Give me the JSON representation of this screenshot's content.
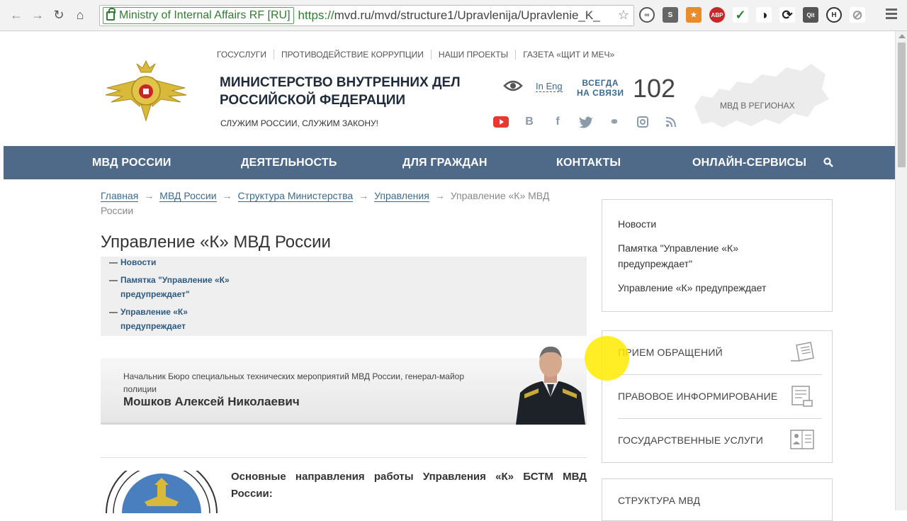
{
  "browser": {
    "ev_label": "Ministry of Internal Affairs RF [RU]",
    "url_protocol": "https://",
    "url_rest": "mvd.ru/mvd/structure1/Upravlenija/Upravlenie_K_",
    "extensions": [
      "S",
      "ABP",
      "Qit",
      "H"
    ]
  },
  "header": {
    "top_links": [
      "ГОСУСЛУГИ",
      "ПРОТИВОДЕЙСТВИЕ КОРРУПЦИИ",
      "НАШИ ПРОЕКТЫ",
      "ГАЗЕТА «ЩИТ И МЕЧ»"
    ],
    "title_line1": "МИНИСТЕРСТВО ВНУТРЕННИХ ДЕЛ",
    "title_line2": "РОССИЙСКОЙ ФЕДЕРАЦИИ",
    "subtitle": "СЛУЖИМ РОССИИ, СЛУЖИМ ЗАКОНУ!",
    "lang_link": "In Eng",
    "hotline_label1": "ВСЕГДА",
    "hotline_label2": "НА СВЯЗИ",
    "hotline_number": "102",
    "regions_label": "МВД В РЕГИОНАХ",
    "socials": [
      "youtube-icon",
      "vk-icon",
      "facebook-icon",
      "twitter-icon",
      "odnoklassniki-icon",
      "instagram-icon",
      "rss-icon"
    ]
  },
  "nav": {
    "items": [
      "МВД РОССИИ",
      "ДЕЯТЕЛЬНОСТЬ",
      "ДЛЯ ГРАЖДАН",
      "КОНТАКТЫ",
      "ОНЛАЙН-СЕРВИСЫ"
    ]
  },
  "breadcrumb": {
    "items": [
      "Главная",
      "МВД России",
      "Структура Министерства",
      "Управления"
    ],
    "current": "Управление «К» МВД России",
    "separator": "→"
  },
  "page": {
    "title": "Управление «К» МВД России",
    "subnav": [
      {
        "line1": "Новости",
        "line2": ""
      },
      {
        "line1": "Памятка \"Управление «К»",
        "line2": "предупреждает\""
      },
      {
        "line1": "Управление «К»",
        "line2": "предупреждает"
      }
    ],
    "person_role": "Начальник Бюро специальных технических мероприятий МВД России, генерал-майор полиции",
    "person_name": "Мошков Алексей Николаевич",
    "directions": "Основные направления работы Управления «К» БСТМ МВД России:"
  },
  "sidebar": {
    "links": [
      "Новости",
      "Памятка \"Управление «К»",
      "предупреждает\"",
      "Управление «К» предупреждает"
    ],
    "services": [
      "ПРИЕМ ОБРАЩЕНИЙ",
      "ПРАВОВОЕ ИНФОРМИРОВАНИЕ",
      "ГОСУДАРСТВЕННЫЕ УСЛУГИ"
    ],
    "structure": "СТРУКТУРА МВД"
  },
  "colors": {
    "nav_bg": "#4e6a88",
    "link": "#3d6b8e",
    "ev_green": "#2e7d32"
  }
}
